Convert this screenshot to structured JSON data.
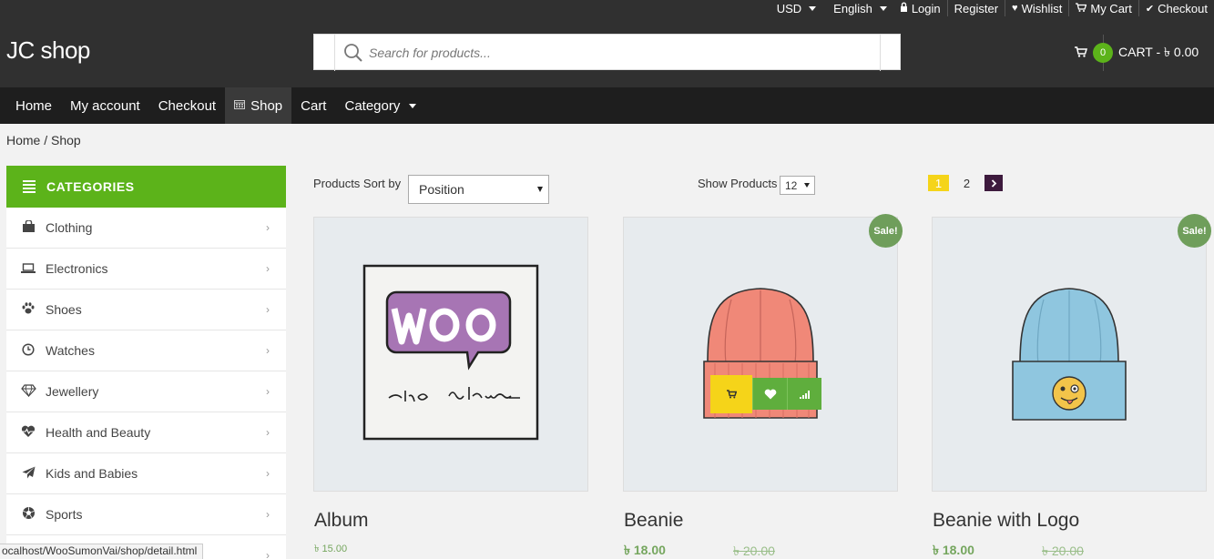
{
  "topbar": {
    "currency": "USD",
    "language": "English",
    "login": "Login",
    "register": "Register",
    "wishlist": "Wishlist",
    "my_cart": "My Cart",
    "checkout": "Checkout"
  },
  "header": {
    "logo": "JC shop",
    "search_placeholder": "Search for products...",
    "cart_count": "0",
    "cart_label": "CART - ৳ 0.00"
  },
  "nav": {
    "items": [
      "Home",
      "My account",
      "Checkout",
      "Shop",
      "Cart",
      "Category"
    ]
  },
  "breadcrumb": "Home / Shop",
  "categories": {
    "title": "CATEGORIES",
    "items": [
      {
        "label": "Clothing",
        "icon": "shopping-bag-icon"
      },
      {
        "label": "Electronics",
        "icon": "laptop-icon"
      },
      {
        "label": "Shoes",
        "icon": "paw-icon"
      },
      {
        "label": "Watches",
        "icon": "clock-icon"
      },
      {
        "label": "Jewellery",
        "icon": "diamond-icon"
      },
      {
        "label": "Health and Beauty",
        "icon": "heartbeat-icon"
      },
      {
        "label": "Kids and Babies",
        "icon": "paper-plane-icon"
      },
      {
        "label": "Sports",
        "icon": "soccer-ball-icon"
      }
    ]
  },
  "toolbar": {
    "sort_label": "Products Sort by",
    "sort_value": "Position",
    "show_label": "Show Products",
    "show_value": "12",
    "pages": [
      "1",
      "2"
    ]
  },
  "products": [
    {
      "name": "Album",
      "price": "৳ 15.00"
    },
    {
      "name": "Beanie",
      "price": "৳ 18.00",
      "old_price": "৳ 20.00",
      "badge": "Sale!"
    },
    {
      "name": "Beanie with Logo",
      "price": "৳ 18.00",
      "old_price": "৳ 20.00",
      "badge": "Sale!"
    }
  ],
  "status_url": "ocalhost/WooSumonVai/shop/detail.html",
  "colors": {
    "header_bg": "#303030",
    "nav_bg": "#1e1e1e",
    "accent_green": "#5cb31a",
    "pager_yellow": "#f5d419",
    "price_green": "#75a65e"
  }
}
